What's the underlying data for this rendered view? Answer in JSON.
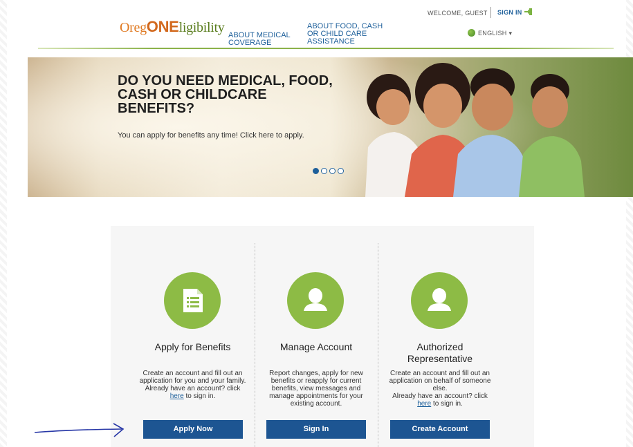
{
  "header": {
    "logo": {
      "part1": "Oreg",
      "part2": "ONE",
      "part3": "ligibility"
    },
    "nav": {
      "medical": "ABOUT MEDICAL COVERAGE",
      "food": "ABOUT FOOD, CASH OR CHILD CARE ASSISTANCE"
    },
    "welcome": "WELCOME, GUEST",
    "signin": "SIGN IN",
    "language": "ENGLISH"
  },
  "hero": {
    "title": "DO YOU NEED MEDICAL, FOOD, CASH OR CHILDCARE BENEFITS?",
    "text": "You can apply for benefits any time! Click here to apply.",
    "slides": 4,
    "active_slide": 1
  },
  "cards": [
    {
      "title": "Apply for Benefits",
      "desc": "Create an account and fill out an application for you and your family.",
      "desc2": "Already have an account? click",
      "link": "here",
      "link_suffix": "to sign in.",
      "button": "Apply Now",
      "icon": "document-list-icon"
    },
    {
      "title": "Manage Account",
      "desc": "Report changes, apply for new benefits or reapply for current benefits, view messages and manage appointments for your existing account.",
      "button": "Sign In",
      "icon": "user-icon"
    },
    {
      "title": "Authorized Representative",
      "desc": "Create an account and fill out an application on behalf of someone else.",
      "desc2": "Already have an account? click",
      "link": "here",
      "link_suffix": "to sign in.",
      "button": "Create Account",
      "icon": "user-icon"
    }
  ],
  "colors": {
    "brand_orange": "#e07b24",
    "brand_green": "#8dbb45",
    "link_blue": "#1d5f9a",
    "button_blue": "#1d5592"
  }
}
